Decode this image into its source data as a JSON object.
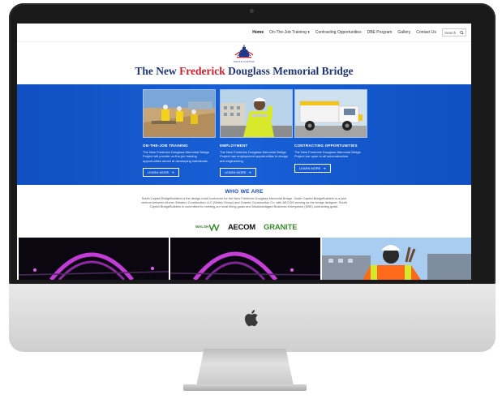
{
  "nav": {
    "items": [
      "Home",
      "On-The-Job Training",
      "Contracting Opportunities",
      "DBE Program",
      "Gallery",
      "Contact Us"
    ],
    "dropdown_caret": "▾",
    "search_placeholder": "Search"
  },
  "header": {
    "logo_text": "SOUTH CAPITOL",
    "title_part1": "The New ",
    "title_highlight": "Frederick",
    "title_part2": " Douglass Memorial Bridge"
  },
  "cards": [
    {
      "title": "ON-THE-JOB TRAINING",
      "description": "The New Frederick Douglass Memorial Bridge Project will provide on-the-job training opportunities aimed at developing individuals.",
      "button": "LEARN MORE"
    },
    {
      "title": "EMPLOYMENT",
      "description": "The New Frederick Douglass Memorial Bridge Project has employment opportunities in design and engineering.",
      "button": "LEARN MORE"
    },
    {
      "title": "CONTRACTING OPPORTUNITIES",
      "description": "The New Frederick Douglass Memorial Bridge Project are open to all subcontractors.",
      "button": "LEARN MORE"
    }
  ],
  "who_we_are": {
    "title": "WHO WE ARE",
    "text": "South Capitol BridgeBuilders is the design-build contractor for the New Frederick Douglass Memorial Bridge. South Capitol BridgeBuilders is a joint venture between Archer Western Construction LLC (Walsh Group) and Granite Construction Co. with AECOM serving as the bridge designer. South Capitol BridgeBuilders is committed to meeting our local hiring goals and Disadvantaged Business Enterprises (DBE) contracting goals."
  },
  "partners": {
    "walsh": "WALSH",
    "aecom": "AECOM",
    "granite": "GRANITE"
  },
  "colors": {
    "brand_blue": "#1860d6",
    "title_navy": "#1e3570",
    "title_red": "#c8202c",
    "granite_green": "#3c8a2d"
  },
  "icons": [
    "search-icon",
    "apple-logo-icon",
    "arrow-right-icon",
    "capitol-dome-icon"
  ]
}
